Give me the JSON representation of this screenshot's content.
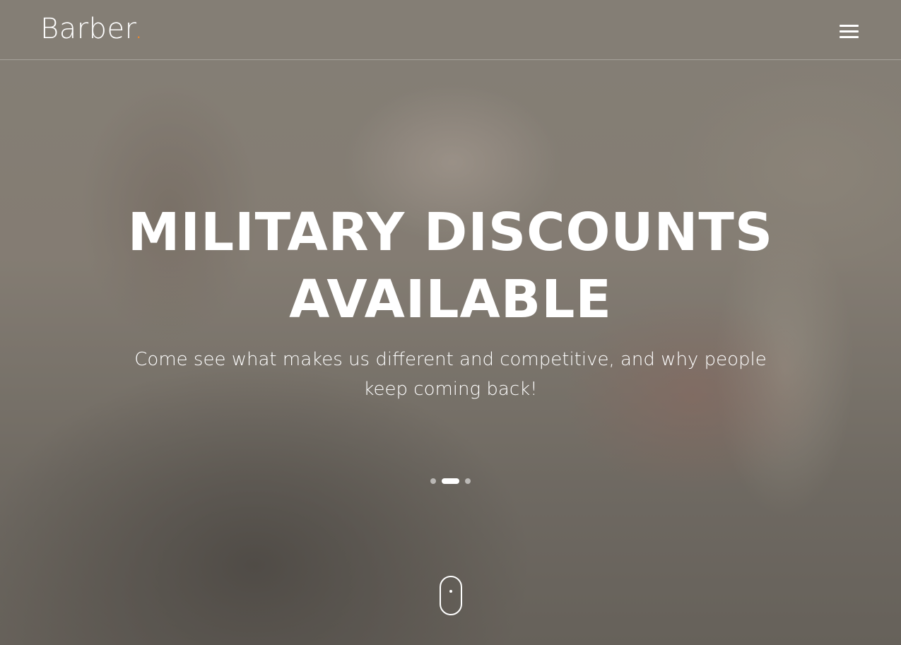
{
  "brand": {
    "name": "Barber",
    "dot": "."
  },
  "nav": {
    "menu_icon": "hamburger-menu-icon"
  },
  "hero": {
    "title_line1": "MILITARY DISCOUNTS",
    "title_line2": "AVAILABLE",
    "subtitle": "Come see what makes us different and competitive, and why people keep coming back!"
  },
  "slider": {
    "slide_count": 3,
    "active_index": 2
  },
  "scroll_indicator": {
    "icon": "mouse-scroll-icon"
  },
  "colors": {
    "accent": "#f08a2c",
    "text": "#ffffff"
  }
}
